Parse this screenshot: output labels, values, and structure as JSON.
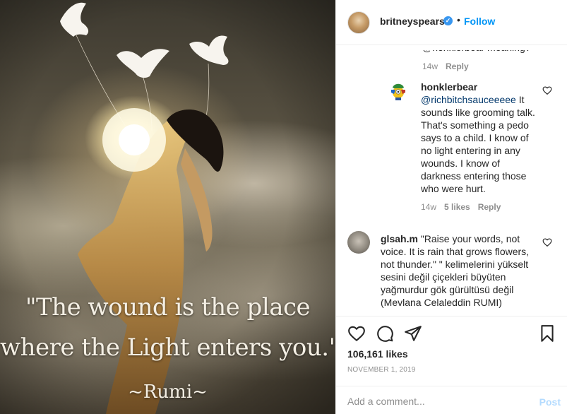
{
  "photo": {
    "quote_line_1": "\"The wound is the place",
    "quote_line_2": "where the Light enters you.\"",
    "quote_author": "~Rumi~"
  },
  "header": {
    "username": "britneyspears",
    "verified_icon": "verified-badge-icon",
    "separator": "•",
    "follow_label": "Follow",
    "accent_color": "#0095f6"
  },
  "comments": {
    "partial_line": "@honklerbear meaning?",
    "partial_meta": {
      "age": "14w",
      "reply_label": "Reply"
    },
    "reply_1": {
      "username": "honklerbear",
      "mention": "@richbitchsauceeeee",
      "text": " It sounds like grooming talk. That's something a pedo says to a child. I know of no light entering in any wounds. I know of darkness entering those who were hurt.",
      "age": "14w",
      "likes": "5 likes",
      "reply_label": "Reply"
    },
    "comment_2": {
      "username": "glsah.m",
      "text": " \"Raise your words, not voice. It is rain that grows flowers, not thunder.\" \" kelimelerini yükselt sesini değil çiçekleri büyüten yağmurdur gök gürültüsü değil (Mevlana Celaleddin RUMI)"
    }
  },
  "actions": {
    "icons": [
      "heart-icon",
      "comment-icon",
      "share-icon",
      "bookmark-icon"
    ],
    "likes_count": "106,161 likes",
    "date": "NOVEMBER 1, 2019"
  },
  "comment_box": {
    "placeholder": "Add a comment...",
    "post_label": "Post"
  }
}
